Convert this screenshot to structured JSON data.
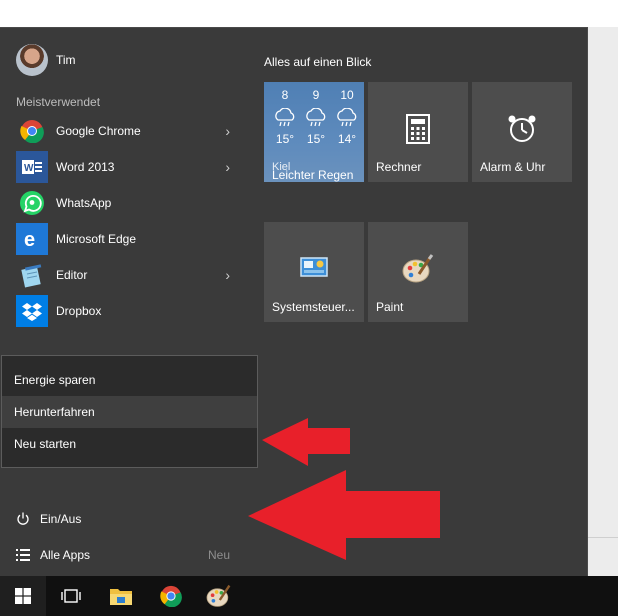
{
  "user": {
    "name": "Tim"
  },
  "most_used": {
    "title": "Meistverwendet",
    "items": [
      {
        "label": "Google Chrome",
        "icon": "chrome-icon",
        "has_submenu": true
      },
      {
        "label": "Word 2013",
        "icon": "word-icon",
        "has_submenu": true
      },
      {
        "label": "WhatsApp",
        "icon": "whatsapp-icon",
        "has_submenu": false
      },
      {
        "label": "Microsoft Edge",
        "icon": "edge-icon",
        "has_submenu": false
      },
      {
        "label": "Editor",
        "icon": "notepad-icon",
        "has_submenu": true
      },
      {
        "label": "Dropbox",
        "icon": "dropbox-icon",
        "has_submenu": false
      }
    ]
  },
  "power_flyout": {
    "items": [
      {
        "label": "Energie sparen"
      },
      {
        "label": "Herunterfahren"
      },
      {
        "label": "Neu starten"
      }
    ]
  },
  "power": {
    "label": "Ein/Aus",
    "icon": "power-icon"
  },
  "all_apps": {
    "label": "Alle Apps",
    "badge": "Neu",
    "icon": "list-icon"
  },
  "tiles": {
    "group_title": "Alles auf einen Blick",
    "weather": {
      "days": [
        "8",
        "9",
        "10"
      ],
      "temps": [
        "15°",
        "15°",
        "14°"
      ],
      "city": "Kiel",
      "condition": "Leichter Regen"
    },
    "calculator": {
      "label": "Rechner"
    },
    "alarms": {
      "label": "Alarm & Uhr"
    },
    "control_panel": {
      "label": "Systemsteuer..."
    },
    "paint": {
      "label": "Paint"
    }
  },
  "taskbar": {
    "items": [
      "windows-start-icon",
      "task-view-icon",
      "file-explorer-icon",
      "chrome-icon",
      "paint-icon"
    ]
  },
  "colors": {
    "menu_bg": "#3a3a3a",
    "tile_bg": "#4d4d4d",
    "weather_tile": "#5e8bbd",
    "taskbar": "#101010",
    "annotation_arrow": "#e8202a"
  }
}
